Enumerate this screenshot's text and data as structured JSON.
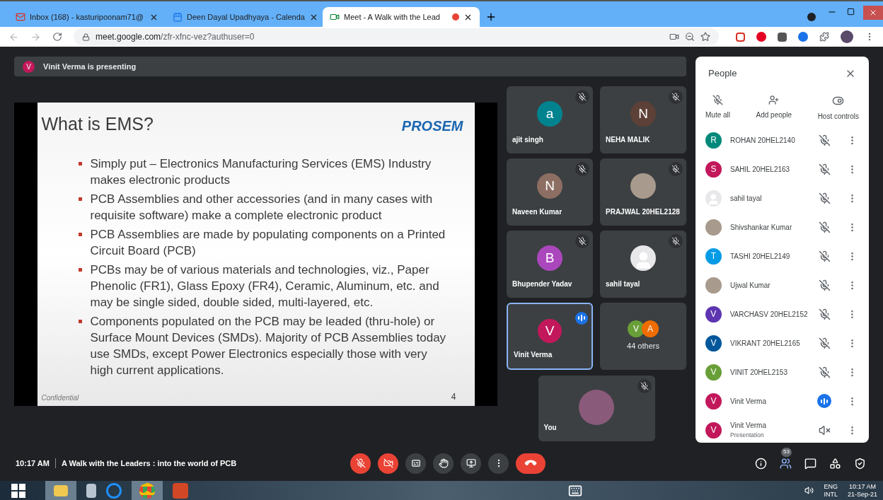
{
  "browser": {
    "tabs": [
      {
        "title": "Inbox (168) - kasturipoonam71@",
        "kind": "mail",
        "selected": false
      },
      {
        "title": "Deen Dayal Upadhyaya - Calenda",
        "kind": "calendar",
        "selected": false
      },
      {
        "title": "Meet - A Walk with the Lead",
        "kind": "meet",
        "selected": true,
        "recording": true
      }
    ],
    "url_host": "meet.google.com",
    "url_path": "/zfr-xfnc-vez?authuser=0"
  },
  "banner": {
    "avatar": "V",
    "color": "#c2185b",
    "text": "Vinit Verma is presenting"
  },
  "slide": {
    "title": "What is EMS?",
    "logo": "PROSEM",
    "bullets": [
      "Simply put – Electronics Manufacturing Services (EMS) Industry makes electronic products",
      "PCB Assemblies and other accessories (and in many cases with requisite software) make a complete electronic product",
      "PCB Assemblies are made by populating components on a Printed Circuit Board (PCB)",
      "PCBs may be of various materials and technologies, viz., Paper Phenolic (FR1), Glass Epoxy (FR4), Ceramic, Aluminum, etc. and may be single sided, double sided, multi-layered, etc.",
      "Components populated on the PCB may be leaded (thru-hole) or Surface Mount Devices (SMDs). Majority of PCB Assemblies today use SMDs, except Power Electronics especially those with very high current applications."
    ],
    "footer": "Confidential",
    "page": "4"
  },
  "tiles": [
    {
      "name": "ajit singh",
      "kind": "initial",
      "initial": "a",
      "color": "#00838f",
      "muted": true,
      "speaking": false,
      "selected": false
    },
    {
      "name": "NEHA MALIK",
      "kind": "initial",
      "initial": "N",
      "color": "#5d4037",
      "muted": true,
      "speaking": false,
      "selected": false
    },
    {
      "name": "Naveen Kumar",
      "kind": "initial",
      "initial": "N",
      "color": "#8d6e63",
      "muted": true,
      "speaking": false,
      "selected": false
    },
    {
      "name": "PRAJWAL 20HEL2128",
      "kind": "photo",
      "muted": true,
      "speaking": false,
      "selected": false
    },
    {
      "name": "Bhupender Yadav",
      "kind": "initial",
      "initial": "B",
      "color": "#ab47bc",
      "muted": true,
      "speaking": false,
      "selected": false
    },
    {
      "name": "sahil tayal",
      "kind": "silhouette",
      "muted": true,
      "speaking": false,
      "selected": false
    },
    {
      "name": "Vinit Verma",
      "kind": "initial",
      "initial": "V",
      "color": "#c2185b",
      "muted": false,
      "speaking": true,
      "selected": true
    }
  ],
  "others": {
    "avatars": [
      {
        "initial": "V",
        "color": "#689f38"
      },
      {
        "initial": "A",
        "color": "#ef6c00"
      }
    ],
    "label": "44 others"
  },
  "self_tile": {
    "name": "You",
    "muted": true
  },
  "people": {
    "title": "People",
    "actions": [
      {
        "label": "Mute all",
        "kind": "mute"
      },
      {
        "label": "Add people",
        "kind": "add"
      },
      {
        "label": "Host controls",
        "kind": "host"
      }
    ],
    "list": [
      {
        "name": "ROHAN 20HEL2140",
        "kind": "initial",
        "initial": "R",
        "color": "#00897b",
        "muted": true,
        "speaking": false
      },
      {
        "name": "SAHIL 20HEL2163",
        "kind": "initial",
        "initial": "S",
        "color": "#c2185b",
        "muted": true,
        "speaking": false
      },
      {
        "name": "sahil tayal",
        "kind": "silhouette",
        "muted": true,
        "speaking": false
      },
      {
        "name": "Shivshankar Kumar",
        "kind": "photo",
        "muted": true,
        "speaking": false
      },
      {
        "name": "TASHI 20HEL2149",
        "kind": "initial",
        "initial": "T",
        "color": "#039be5",
        "muted": true,
        "speaking": false
      },
      {
        "name": "Ujwal Kumar",
        "kind": "photo",
        "muted": true,
        "speaking": false
      },
      {
        "name": "VARCHASV 20HEL2152",
        "kind": "initial",
        "initial": "V",
        "color": "#5e35b1",
        "muted": true,
        "speaking": false
      },
      {
        "name": "VIKRANT 20HEL2165",
        "kind": "initial",
        "initial": "V",
        "color": "#01579b",
        "muted": true,
        "speaking": false
      },
      {
        "name": "VINIT 20HEL2153",
        "kind": "initial",
        "initial": "V",
        "color": "#689f38",
        "muted": true,
        "speaking": false
      },
      {
        "name": "Vinit Verma",
        "kind": "initial",
        "initial": "V",
        "color": "#c2185b",
        "muted": false,
        "speaking": true
      },
      {
        "name": "Vinit Verma",
        "subtitle": "Presentation",
        "kind": "initial",
        "initial": "V",
        "color": "#c2185b",
        "sound_muted": true
      }
    ]
  },
  "bottom": {
    "time": "10:17 AM",
    "meeting": "A Walk with the Leaders : into the world of PCB",
    "mic_on": false,
    "camera_on": false,
    "people_count": "53"
  },
  "taskbar": {
    "lang": "ENG",
    "layout": "INTL",
    "time": "10:17 AM",
    "date": "21-Sep-21"
  }
}
